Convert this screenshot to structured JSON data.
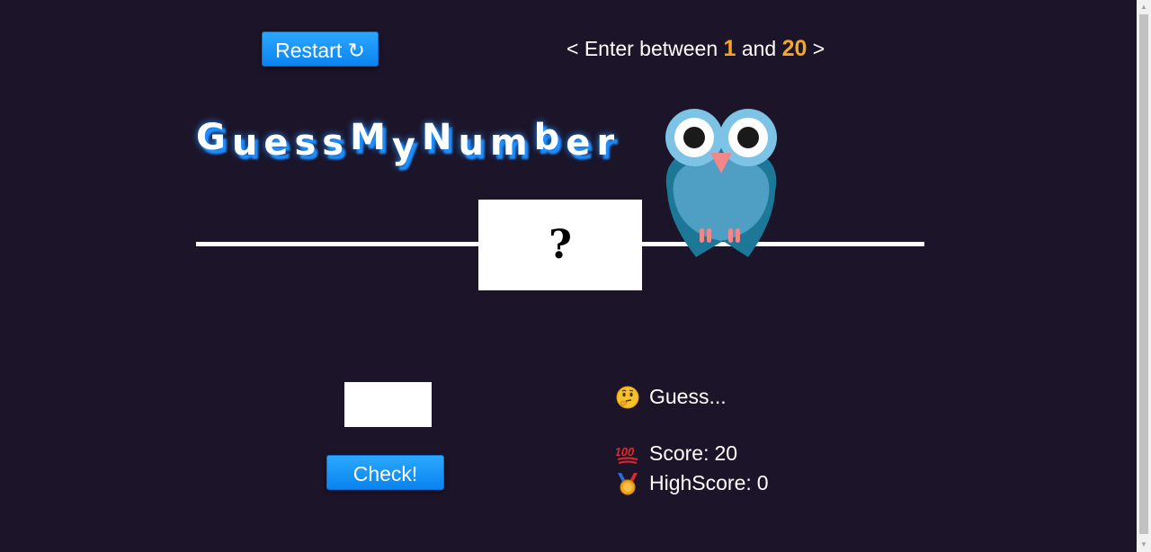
{
  "controls": {
    "restart_label": "Restart ↻",
    "check_label": "Check!",
    "guess_value": ""
  },
  "range_hint": {
    "prefix": "< Enter between ",
    "min": "1",
    "middle": " and ",
    "max": "20",
    "suffix": " >"
  },
  "title": [
    "G",
    "u",
    "e",
    "s",
    "s",
    "M",
    "y",
    "N",
    "u",
    "m",
    "b",
    "e",
    "r"
  ],
  "secret": {
    "display": "?"
  },
  "status": {
    "message": "Guess...",
    "message_icon": "thinking-face-icon",
    "score_label": "Score: ",
    "score": "20",
    "score_icon": "hundred-points-icon",
    "highscore_label": "HighScore: ",
    "highscore": "0",
    "highscore_icon": "medal-icon"
  },
  "colors": {
    "background": "#1c1429",
    "accent_button": "#0a84f0",
    "range_number": "#f5a623",
    "title_shadow": "#1f8fff",
    "owl_body": "#4f9ec3",
    "owl_dark": "#1d7898"
  }
}
